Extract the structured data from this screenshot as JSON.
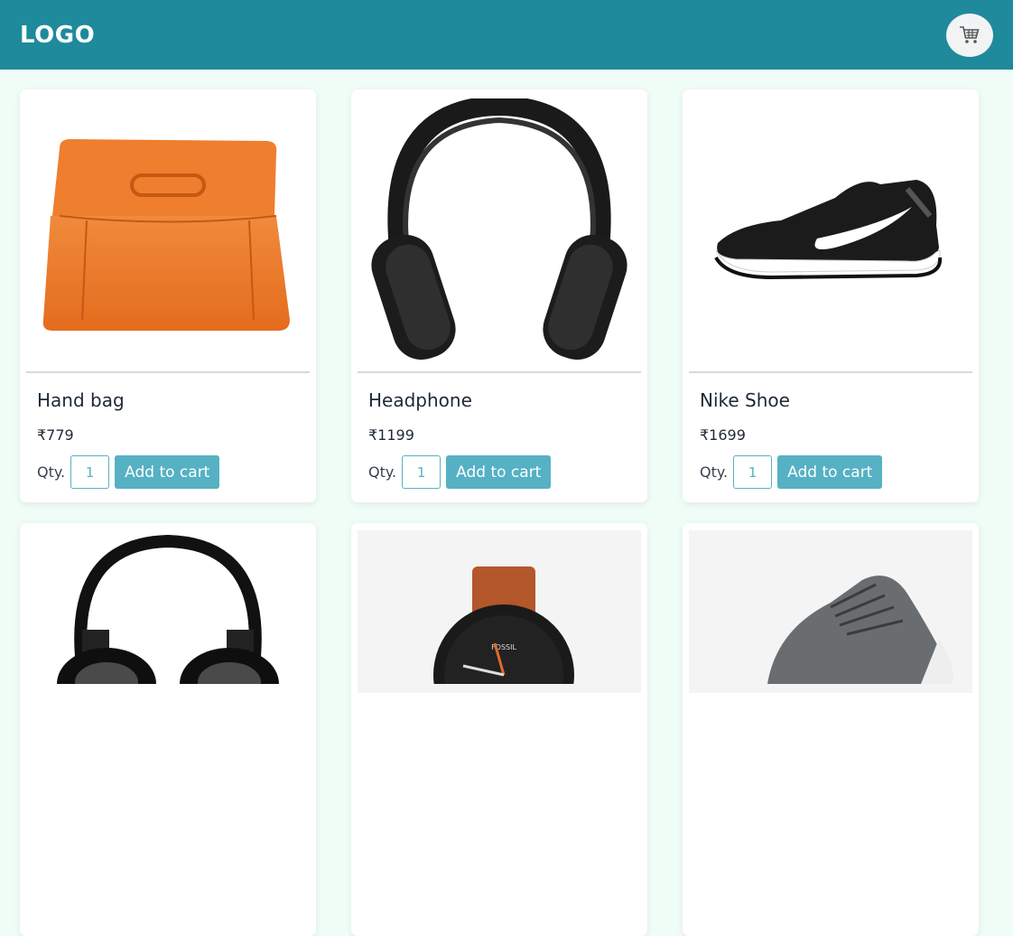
{
  "header": {
    "logo": "LOGO",
    "cart_icon": "shopping-cart-icon"
  },
  "products": [
    {
      "name": "Hand bag",
      "price": "₹779",
      "qty_label": "Qty.",
      "qty_value": "1",
      "button": "Add to cart",
      "image": "orange-handbag-image"
    },
    {
      "name": "Headphone",
      "price": "₹1199",
      "qty_label": "Qty.",
      "qty_value": "1",
      "button": "Add to cart",
      "image": "black-headphone-image"
    },
    {
      "name": "Nike Shoe",
      "price": "₹1699",
      "qty_label": "Qty.",
      "qty_value": "1",
      "button": "Add to cart",
      "image": "nike-shoe-image"
    },
    {
      "image": "black-headphone-image"
    },
    {
      "image": "fossil-watch-image"
    },
    {
      "image": "grey-sneaker-image"
    }
  ],
  "colors": {
    "header_bg": "#1e8a9b",
    "page_bg": "#f0fdf6",
    "button_bg": "#56b1c4"
  }
}
